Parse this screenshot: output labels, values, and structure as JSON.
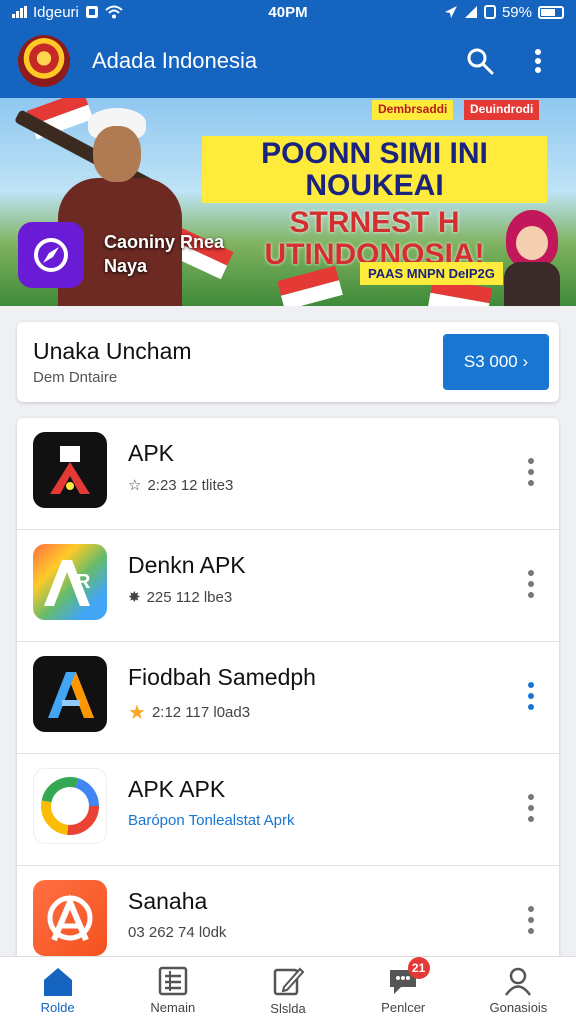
{
  "status_bar": {
    "carrier": "Idgeuri",
    "time": "40PM",
    "battery": "59%"
  },
  "app_bar": {
    "title": "Adada Indonesia"
  },
  "banner": {
    "tag_left": "Dembrsaddi",
    "tag_right": "Deuindrodi",
    "headline_1": "POONN SIMI INI NOUKEAI",
    "headline_2": "STRNEST H UTINDONOSIA!",
    "app_name_1": "Caoniny Rnea",
    "app_name_2": "Naya",
    "pass_label": "PAAS MNPN DeIP2G"
  },
  "promo": {
    "title": "Unaka Uncham",
    "subtitle": "Dem Dntaire",
    "button_label": "S3 000 ›"
  },
  "apps": [
    {
      "name": "APK",
      "meta": "2:23 12 tlite3",
      "meta_icon": "☆"
    },
    {
      "name": "Denkn APK",
      "meta": "225 112 lbe3",
      "meta_icon": "✸"
    },
    {
      "name": "Fiodbah Samedph",
      "meta": "2:12 117 l0ad3",
      "meta_icon": "★"
    },
    {
      "name": "APK APK",
      "meta": "Barópon Tonlealstat Aprk",
      "meta_icon": ""
    },
    {
      "name": "Sanaha",
      "meta": "03 262 74 l0dk",
      "meta_icon": ""
    }
  ],
  "bottom_nav": [
    {
      "label": "Rolde",
      "icon": "home-icon"
    },
    {
      "label": "Nemain",
      "icon": "list-icon"
    },
    {
      "label": "Slslda",
      "icon": "edit-icon"
    },
    {
      "label": "Penlcer",
      "icon": "chat-icon",
      "badge": "21"
    },
    {
      "label": "Gonasiois",
      "icon": "person-icon"
    }
  ],
  "colors": {
    "primary": "#1565c0",
    "accent_blue": "#1976d2",
    "badge_red": "#e53935"
  }
}
